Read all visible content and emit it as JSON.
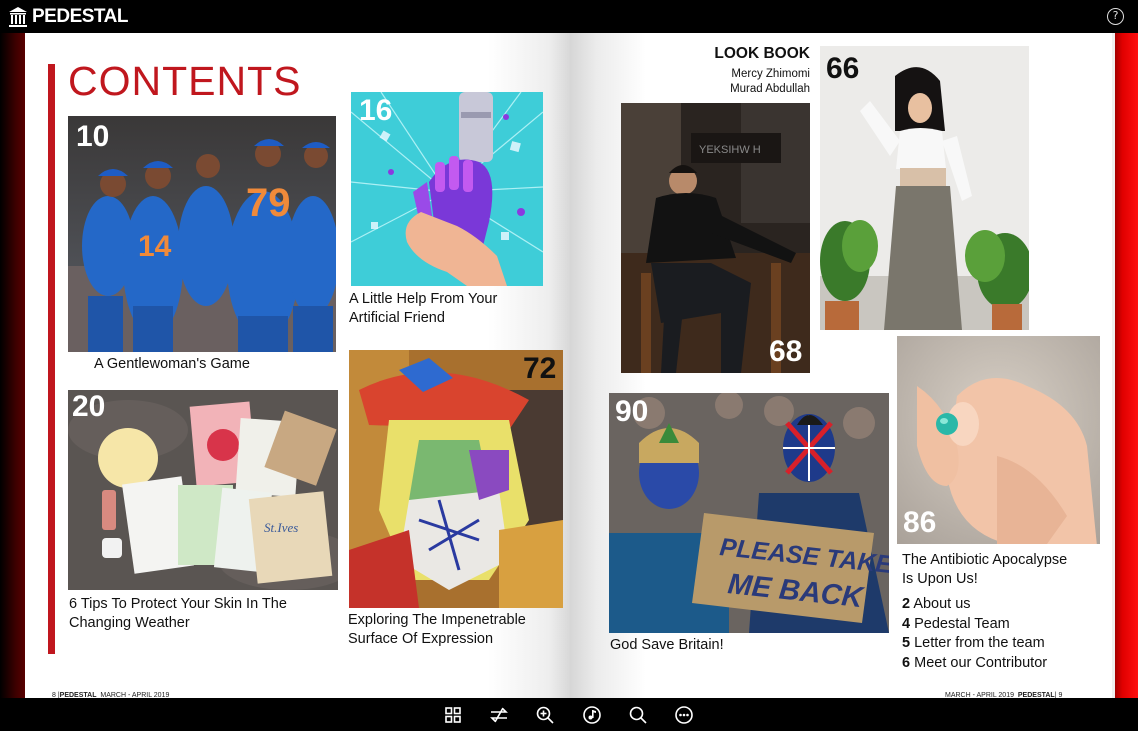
{
  "app": {
    "brand": "PEDESTAL",
    "help_label": "?"
  },
  "contents": {
    "title": "CONTENTS"
  },
  "articles": [
    {
      "page": "10",
      "caption": "A Gentlewoman's Game"
    },
    {
      "page": "16",
      "caption_line1": "A Little Help From Your",
      "caption_line2": "Artificial Friend"
    },
    {
      "page": "20",
      "caption_line1": "6 Tips To Protect Your Skin In  The",
      "caption_line2": "Changing Weather"
    },
    {
      "page": "72",
      "caption_line1": "Exploring The Impenetrable",
      "caption_line2": "Surface Of Expression"
    },
    {
      "page": "68"
    },
    {
      "page": "66"
    },
    {
      "page": "90",
      "caption": "God Save Britain!"
    },
    {
      "page": "86",
      "caption_line1": "The Antibiotic Apocalypse",
      "caption_line2": "Is Upon Us!"
    }
  ],
  "lookbook": {
    "title": "LOOK BOOK",
    "names": [
      "Mercy Zhimomi",
      "Murad Abdullah"
    ]
  },
  "sign_text": {
    "line1": "PLEASE TAKE",
    "line2": "ME BACK"
  },
  "toc": [
    {
      "num": "2",
      "label": "About us"
    },
    {
      "num": "4",
      "label": "Pedestal Team"
    },
    {
      "num": "5",
      "label": "Letter from the team"
    },
    {
      "num": "6",
      "label": "Meet our Contributor"
    }
  ],
  "folio": {
    "left_page": "8 |",
    "left_brand": "PEDESTAL",
    "left_issue": "MARCH - APRIL 2019",
    "right_issue": "MARCH - APRIL 2019",
    "right_brand": "PEDESTAL",
    "right_page": "| 9"
  },
  "toolbar": {
    "icons": [
      "grid-icon",
      "swap-icon",
      "zoom-in-icon",
      "music-icon",
      "search-icon",
      "more-icon"
    ]
  },
  "colors": {
    "accent_red": "#c0171e",
    "bar": "#000000"
  }
}
